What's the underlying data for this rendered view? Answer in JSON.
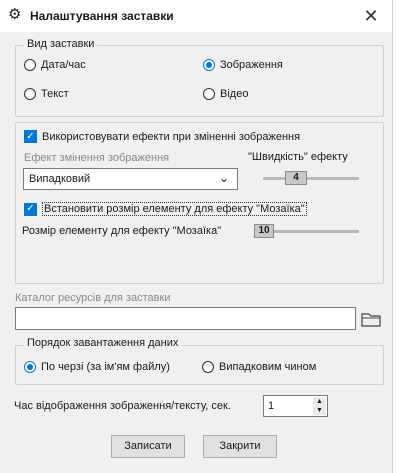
{
  "window": {
    "title": "Налаштування заставки",
    "icon": "gear-icon",
    "close_icon": "close-icon"
  },
  "view_group": {
    "legend": "Вид заставки",
    "options": [
      {
        "label": "Дата/час",
        "checked": false
      },
      {
        "label": "Зображення",
        "checked": true
      },
      {
        "label": "Текст",
        "checked": false
      },
      {
        "label": "Відео",
        "checked": false
      }
    ]
  },
  "effects_group": {
    "use_effects_label": "Використовувати ефекти при зміненні зображення",
    "use_effects_checked": true,
    "effect_label": "Ефект змінення зображення",
    "effect_value": "Випадковий",
    "speed_label": "\"Швидкість\" ефекту",
    "speed_value": "4",
    "mosaic_checkbox_label": "Встановити розмір елементу для ефекту \"Мозаїка\"",
    "mosaic_checked": true,
    "mosaic_size_label": "Розмір елементу для ефекту \"Мозаїка\"",
    "mosaic_size_value": "10"
  },
  "catalog": {
    "label": "Каталог ресурсів для заставки",
    "value": "",
    "browse_icon": "folder-icon"
  },
  "order_group": {
    "legend": "Порядок завантаження даних",
    "options": [
      {
        "label": "По черзі (за ім'ям файлу)",
        "checked": true
      },
      {
        "label": "Випадковим чином",
        "checked": false
      }
    ]
  },
  "display_time": {
    "label": "Час відображення зображення/тексту, сек.",
    "value": "1"
  },
  "buttons": {
    "save": "Записати",
    "close": "Закрити"
  },
  "colors": {
    "accent": "#0078d7"
  }
}
